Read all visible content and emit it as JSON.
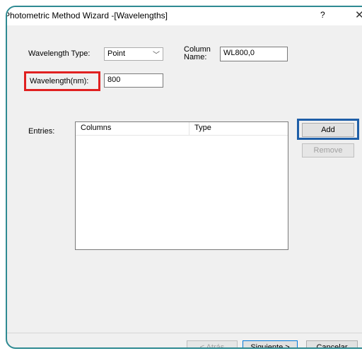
{
  "window": {
    "title": "Photometric Method Wizard -[Wavelengths]",
    "help": "?",
    "close": "✕"
  },
  "form": {
    "wavelength_type_label": "Wavelength Type:",
    "wavelength_type_value": "Point",
    "dropdown_arrow": "﹀",
    "column_name_label_line1": "Column",
    "column_name_label_line2": "Name:",
    "column_name_value": "WL800,0",
    "wavelength_label": "Wavelength(nm):",
    "wavelength_value": "800",
    "entries_label": "Entries:"
  },
  "entries": {
    "columns": [
      "Columns",
      "Type"
    ],
    "rows": []
  },
  "buttons": {
    "add": "Add",
    "remove": "Remove",
    "back": "< Atrás",
    "next": "Siguiente >",
    "cancel": "Cancelar"
  },
  "colors": {
    "highlight_red": "#e02020",
    "highlight_blue": "#1f5fa8",
    "frame_teal": "#2e8a92"
  }
}
